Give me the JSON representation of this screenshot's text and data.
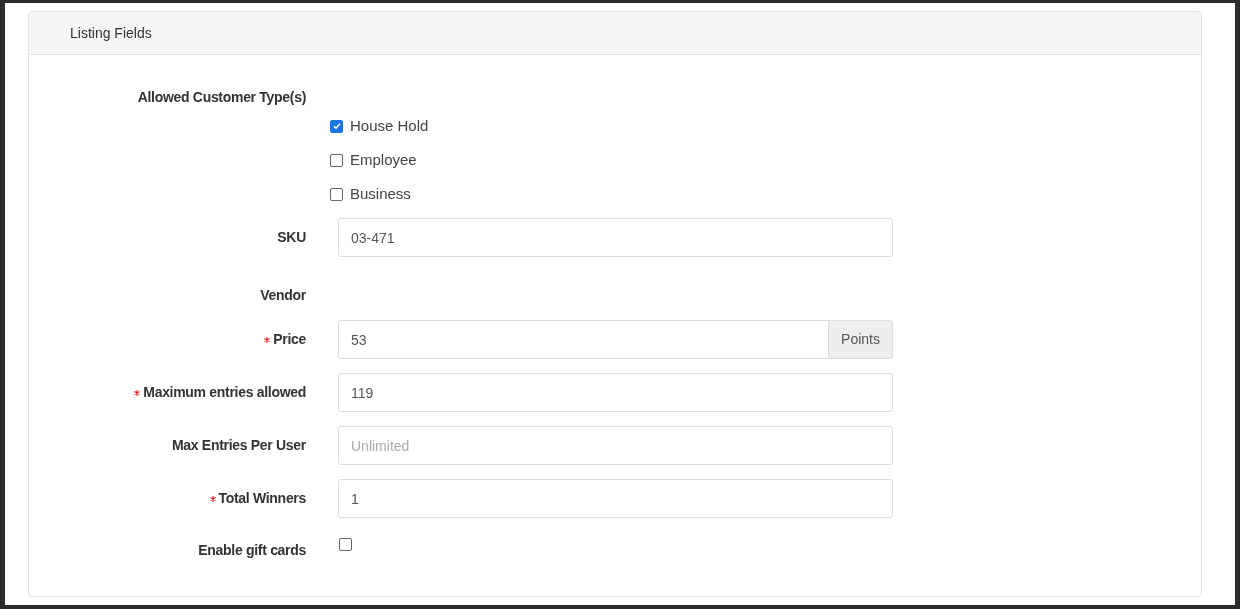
{
  "panel": {
    "title": "Listing Fields"
  },
  "fields": [
    {
      "kind": "checkbox_group",
      "label": "Allowed Customer Type(s)",
      "required": false,
      "options": [
        {
          "label": "House Hold",
          "checked": true
        },
        {
          "label": "Employee",
          "checked": false
        },
        {
          "label": "Business",
          "checked": false
        }
      ]
    },
    {
      "kind": "text",
      "label": "SKU",
      "required": false,
      "value": "03-471"
    },
    {
      "kind": "static",
      "label": "Vendor",
      "required": false
    },
    {
      "kind": "addon",
      "label": "Price",
      "required": true,
      "value": "53",
      "addon": "Points"
    },
    {
      "kind": "text",
      "label": "Maximum entries allowed",
      "required": true,
      "value": "119"
    },
    {
      "kind": "text",
      "label": "Max Entries Per User",
      "required": false,
      "placeholder": "Unlimited"
    },
    {
      "kind": "text",
      "label": "Total Winners",
      "required": true,
      "value": "1"
    },
    {
      "kind": "checkbox",
      "label": "Enable gift cards",
      "required": false,
      "checked": false
    }
  ]
}
